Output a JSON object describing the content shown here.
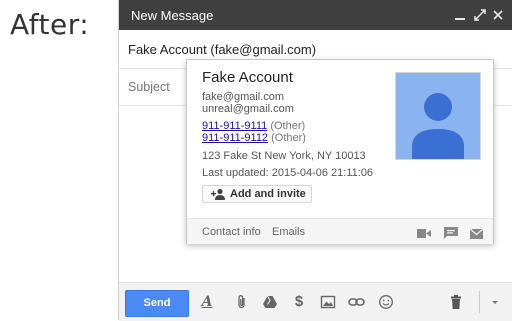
{
  "annotation": {
    "label": "After:"
  },
  "compose": {
    "title": "New Message",
    "to_value": "Fake Account (fake@gmail.com)",
    "subject_placeholder": "Subject",
    "header_icons": [
      "minimize-icon",
      "expand-icon",
      "close-icon"
    ]
  },
  "contact_card": {
    "name": "Fake Account",
    "emails": [
      "fake@gmail.com",
      "unreal@gmail.com"
    ],
    "phones": [
      {
        "number": "911-911-9111",
        "type": "(Other)"
      },
      {
        "number": "911-911-9112",
        "type": "(Other)"
      }
    ],
    "address": "123 Fake St New York, NY 10013",
    "last_updated": "Last updated: 2015-04-06 21:11:06",
    "add_button": "Add and invite",
    "footer": {
      "contact_info": "Contact info",
      "emails": "Emails"
    },
    "footer_icons": [
      "video-call-icon",
      "chat-icon",
      "mail-icon"
    ]
  },
  "toolbar": {
    "send_label": "Send",
    "format_glyph": "A",
    "money_glyph": "$",
    "icons": [
      "formatting-icon",
      "attach-icon",
      "drive-icon",
      "money-icon",
      "photo-icon",
      "link-icon",
      "emoji-icon",
      "trash-icon",
      "more-options-icon"
    ]
  },
  "colors": {
    "header_bg": "#404040",
    "send_button": "#4a8af4",
    "avatar_bg": "#8ab4f0",
    "avatar_fg": "#3b6fd4",
    "link": "#1a0dab"
  }
}
